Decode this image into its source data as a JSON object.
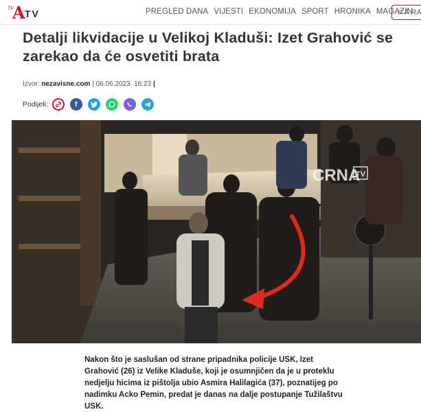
{
  "header": {
    "logo_text": "ATV",
    "logo_small": "tv",
    "nav": [
      "PREGLED DANA",
      "VIJESTI",
      "EKONOMIJA",
      "SPORT",
      "HRONIKA",
      "MAGAZIN"
    ],
    "radio_label": "♫ A RA"
  },
  "article": {
    "title": "Detalji likvidacije u Velikoj Kladuši: Izet Grahović se zarekao da će osvetiti brata",
    "source_label": "Izvor:",
    "source": "nezavisne.com",
    "separator": "|",
    "date": "06.06.2023. 16:23",
    "share_label": "Podijeli:",
    "body": "Nakon što je saslušan od strane pripadnika policije USK, Izet Grahović (26) iz Velike Kladuše, koji je osumnjičen da je u proteklu nedjelju hicima iz pištolja ubio Asmira Halilagića (37), poznatijeg po nadimku Acko Pemin, predat je danas na dalje postupanje Tužilaštvu USK."
  },
  "photo": {
    "watermark": "CRNA",
    "watermark_tv": "TV",
    "arrow_color": "#e02a1e"
  },
  "colors": {
    "brand": "#c8102e"
  }
}
